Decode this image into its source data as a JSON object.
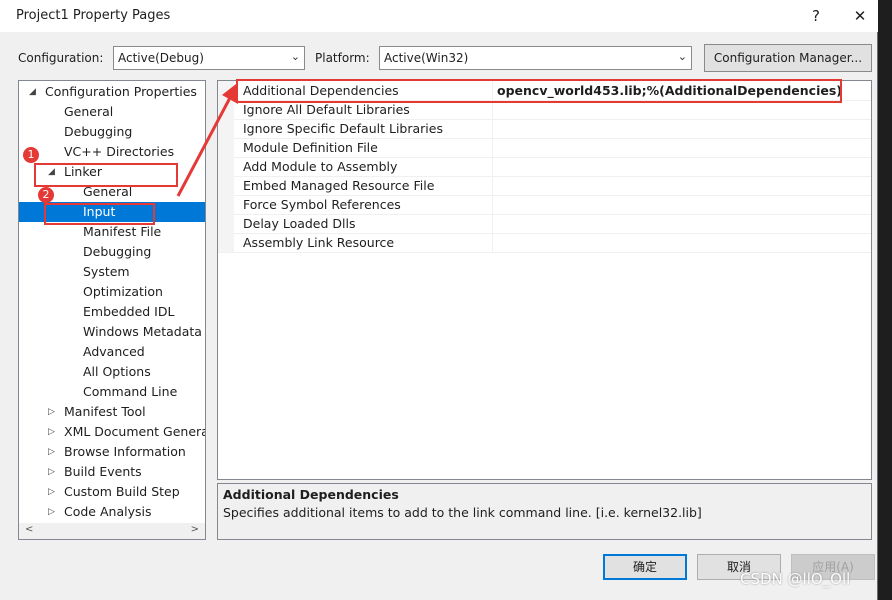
{
  "window": {
    "title": "Project1 Property Pages",
    "help_glyph": "?",
    "close_glyph": "✕"
  },
  "config_bar": {
    "configuration_label": "Configuration:",
    "configuration_value": "Active(Debug)",
    "platform_label": "Platform:",
    "platform_value": "Active(Win32)",
    "manager_button": "Configuration Manager..."
  },
  "tree": {
    "items": [
      {
        "label": "Configuration Properties",
        "indent": 0,
        "arrow": "◢",
        "selected": false
      },
      {
        "label": "General",
        "indent": 1,
        "arrow": "",
        "selected": false
      },
      {
        "label": "Debugging",
        "indent": 1,
        "arrow": "",
        "selected": false
      },
      {
        "label": "VC++ Directories",
        "indent": 1,
        "arrow": "",
        "selected": false
      },
      {
        "label": "Linker",
        "indent": 1,
        "arrow": "◢",
        "selected": false
      },
      {
        "label": "General",
        "indent": 2,
        "arrow": "",
        "selected": false
      },
      {
        "label": "Input",
        "indent": 2,
        "arrow": "",
        "selected": true
      },
      {
        "label": "Manifest File",
        "indent": 2,
        "arrow": "",
        "selected": false
      },
      {
        "label": "Debugging",
        "indent": 2,
        "arrow": "",
        "selected": false
      },
      {
        "label": "System",
        "indent": 2,
        "arrow": "",
        "selected": false
      },
      {
        "label": "Optimization",
        "indent": 2,
        "arrow": "",
        "selected": false
      },
      {
        "label": "Embedded IDL",
        "indent": 2,
        "arrow": "",
        "selected": false
      },
      {
        "label": "Windows Metadata",
        "indent": 2,
        "arrow": "",
        "selected": false
      },
      {
        "label": "Advanced",
        "indent": 2,
        "arrow": "",
        "selected": false
      },
      {
        "label": "All Options",
        "indent": 2,
        "arrow": "",
        "selected": false
      },
      {
        "label": "Command Line",
        "indent": 2,
        "arrow": "",
        "selected": false
      },
      {
        "label": "Manifest Tool",
        "indent": 1,
        "arrow": "▷",
        "selected": false
      },
      {
        "label": "XML Document Generat",
        "indent": 1,
        "arrow": "▷",
        "selected": false
      },
      {
        "label": "Browse Information",
        "indent": 1,
        "arrow": "▷",
        "selected": false
      },
      {
        "label": "Build Events",
        "indent": 1,
        "arrow": "▷",
        "selected": false
      },
      {
        "label": "Custom Build Step",
        "indent": 1,
        "arrow": "▷",
        "selected": false
      },
      {
        "label": "Code Analysis",
        "indent": 1,
        "arrow": "▷",
        "selected": false
      }
    ],
    "scroll_left": "<",
    "scroll_right": ">"
  },
  "grid": {
    "rows": [
      {
        "name": "Additional Dependencies",
        "value": "opencv_world453.lib;%(AdditionalDependencies)"
      },
      {
        "name": "Ignore All Default Libraries",
        "value": ""
      },
      {
        "name": "Ignore Specific Default Libraries",
        "value": ""
      },
      {
        "name": "Module Definition File",
        "value": ""
      },
      {
        "name": "Add Module to Assembly",
        "value": ""
      },
      {
        "name": "Embed Managed Resource File",
        "value": ""
      },
      {
        "name": "Force Symbol References",
        "value": ""
      },
      {
        "name": "Delay Loaded Dlls",
        "value": ""
      },
      {
        "name": "Assembly Link Resource",
        "value": ""
      }
    ]
  },
  "description": {
    "title": "Additional Dependencies",
    "text": "Specifies additional items to add to the link command line. [i.e. kernel32.lib]"
  },
  "buttons": {
    "ok": "确定",
    "cancel": "取消",
    "apply": "应用(A)"
  },
  "annotations": {
    "badge1": "1",
    "badge2": "2",
    "color": "#e53935"
  },
  "watermark": "CSDN @llO_Oll"
}
